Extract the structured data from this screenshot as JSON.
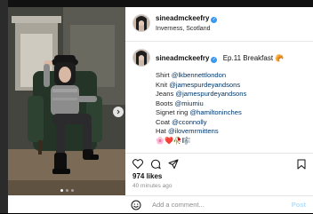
{
  "post": {
    "username": "sineadmckeefry",
    "location": "Inverness, Scotland",
    "caption_title": "Ep.11 Breakfast 🥐",
    "caption_lines": [
      {
        "label": "Shirt",
        "tag": "@lkbennettlondon"
      },
      {
        "label": "Knit",
        "tag": "@jamespurdeyandsons"
      },
      {
        "label": "Jeans",
        "tag": "@jamespurdeyandsons"
      },
      {
        "label": "Boots",
        "tag": "@miumiu"
      },
      {
        "label": "Signet ring",
        "tag": "@hamiltoninches"
      },
      {
        "label": "Coat",
        "tag": "@cconnolly"
      },
      {
        "label": "Hat",
        "tag": "@ilovemrmittens"
      }
    ],
    "caption_emojis": "🌸❤️🥀🎼",
    "likes": "974 likes",
    "time_ago": "40 minutes ago",
    "comment_placeholder": "Add a comment...",
    "post_button": "Post"
  },
  "carousel": {
    "total": 3,
    "active": 1
  },
  "icons": {
    "like": "heart-icon",
    "comment": "comment-bubble-icon",
    "share": "paper-plane-icon",
    "save": "bookmark-icon",
    "emoji": "smiley-icon",
    "next": "chevron-right-icon",
    "verified": "verified-badge-icon"
  }
}
